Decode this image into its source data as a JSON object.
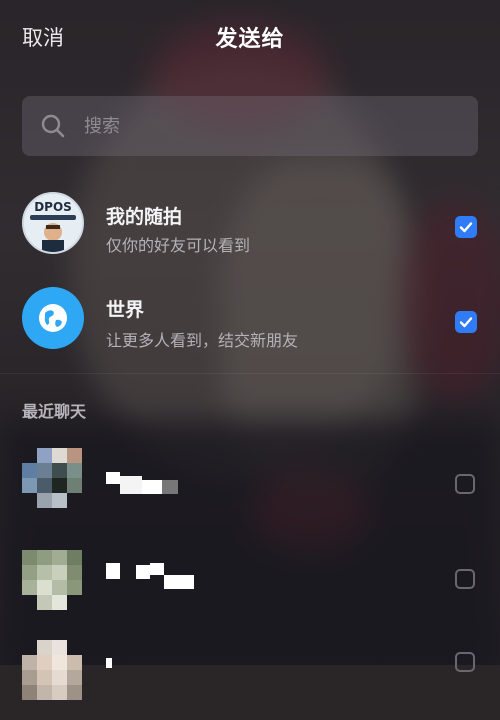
{
  "header": {
    "cancel_label": "取消",
    "title": "发送给"
  },
  "search": {
    "placeholder": "搜索"
  },
  "targets": [
    {
      "title": "我的随拍",
      "subtitle": "仅你的好友可以看到",
      "checked": true,
      "avatar_text": "DPOS"
    },
    {
      "title": "世界",
      "subtitle": "让更多人看到，结交新朋友",
      "checked": true
    }
  ],
  "recent": {
    "section_label": "最近聊天",
    "contacts": [
      {
        "checked": false
      },
      {
        "checked": false
      },
      {
        "checked": false
      }
    ]
  },
  "colors": {
    "accent_blue": "#2f7cf6",
    "world_icon_bg": "#2ea8f5"
  },
  "icons": {
    "search": "search-icon",
    "world": "globe-icon",
    "checked": "checkmark-icon"
  }
}
